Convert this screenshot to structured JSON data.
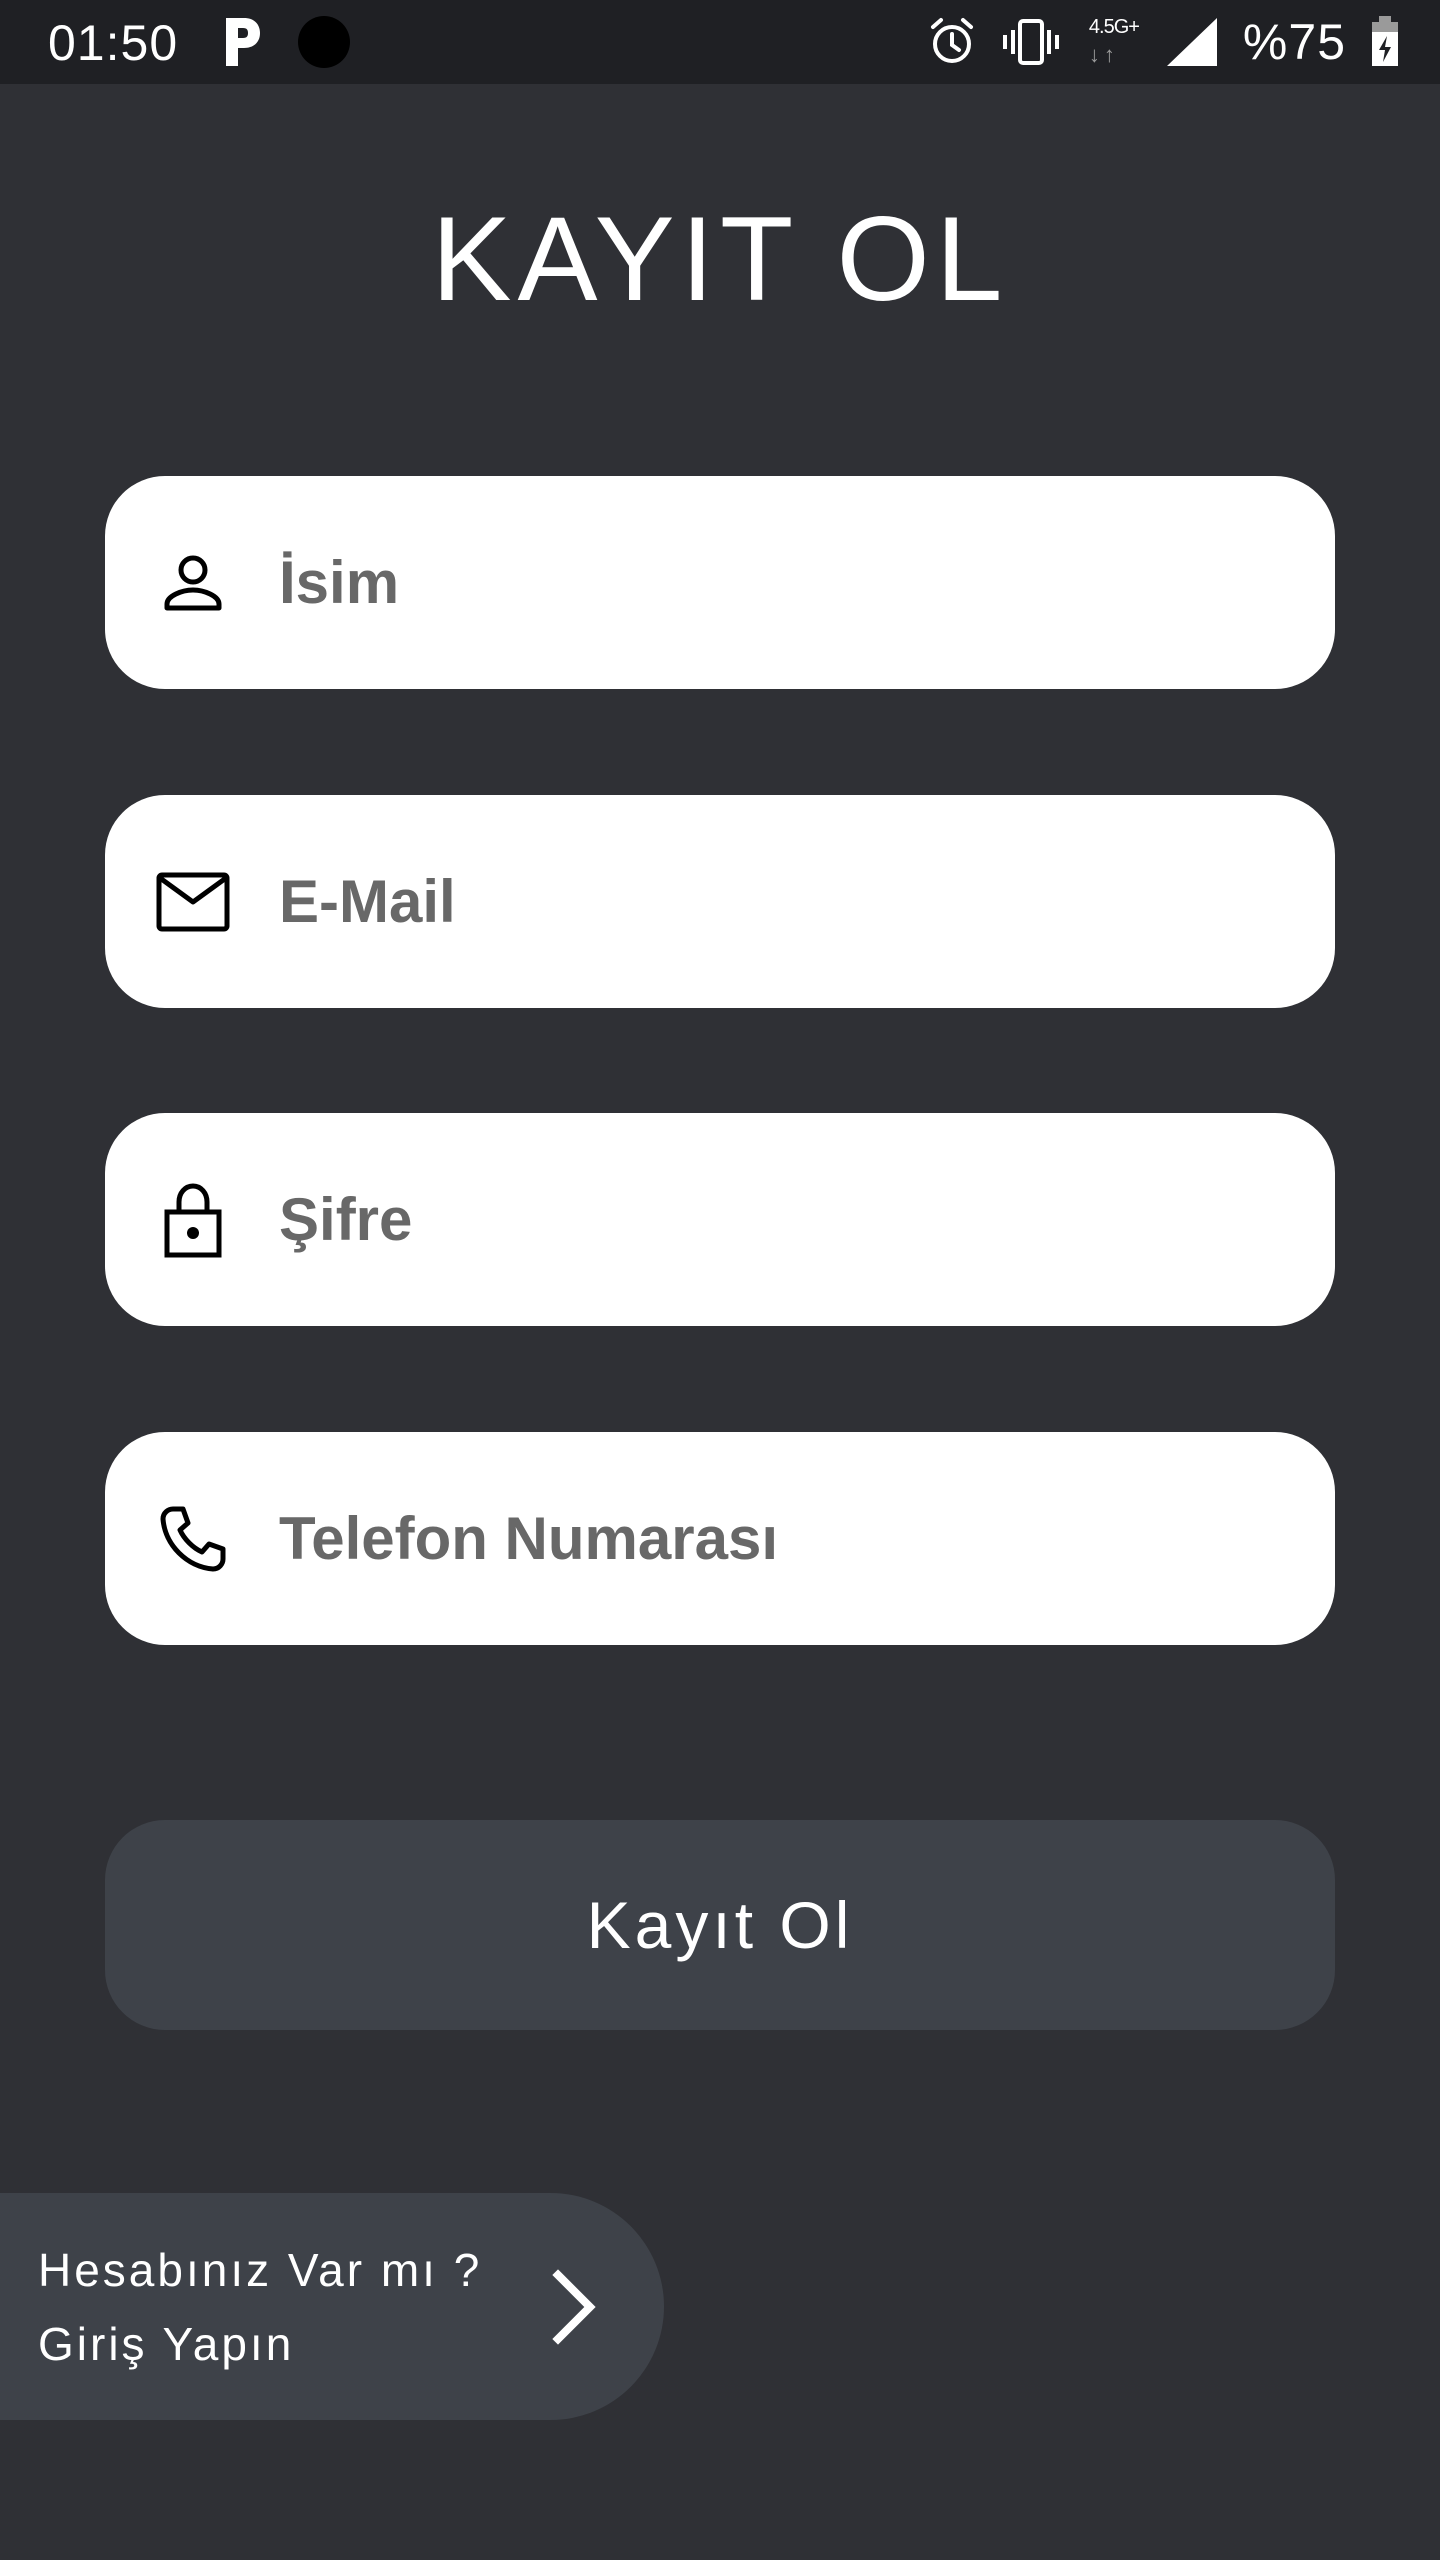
{
  "status_bar": {
    "time": "01:50",
    "network": "4.5G+",
    "battery": "%75",
    "icons": [
      "parking-icon",
      "camera-dot",
      "alarm-icon",
      "vibrate-icon",
      "signal-icon",
      "battery-charging-icon"
    ]
  },
  "title": "KAYIT OL",
  "form": {
    "name_placeholder": "İsim",
    "email_placeholder": "E-Mail",
    "password_placeholder": "Şifre",
    "phone_placeholder": "Telefon Numarası"
  },
  "submit_label": "Kayıt Ol",
  "login_link": {
    "line1": "Hesabınız Var mı ?",
    "line2": "Giriş Yapın"
  },
  "colors": {
    "background": "#2f3035",
    "status_bar": "#1f2024",
    "field_bg": "#ffffff",
    "placeholder": "#686868",
    "button_bg": "#3e4249",
    "text_light": "#ffffff"
  }
}
